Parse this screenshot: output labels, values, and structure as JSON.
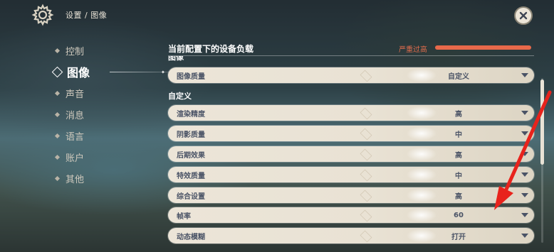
{
  "header": {
    "breadcrumb": "设置 / 图像",
    "gear_icon": "gear-icon",
    "close_icon": "close-icon"
  },
  "sidebar": {
    "items": [
      {
        "label": "控制",
        "active": false
      },
      {
        "label": "图像",
        "active": true
      },
      {
        "label": "声音",
        "active": false
      },
      {
        "label": "消息",
        "active": false
      },
      {
        "label": "语言",
        "active": false
      },
      {
        "label": "账户",
        "active": false
      },
      {
        "label": "其他",
        "active": false
      }
    ]
  },
  "load": {
    "title": "当前配置下的设备负载",
    "status": "严重过高",
    "status_color": "#e8694a"
  },
  "sections": {
    "image_partial": "图像",
    "custom": "自定义"
  },
  "settings": {
    "quality": {
      "label": "图像质量",
      "value": "自定义"
    },
    "rows": [
      {
        "label": "渲染精度",
        "value": "高"
      },
      {
        "label": "阴影质量",
        "value": "中"
      },
      {
        "label": "后期效果",
        "value": "高"
      },
      {
        "label": "特效质量",
        "value": "中"
      },
      {
        "label": "综合设置",
        "value": "高"
      },
      {
        "label": "帧率",
        "value": "60"
      },
      {
        "label": "动态模糊",
        "value": "打开"
      }
    ]
  },
  "annotation": {
    "color": "#e8231c"
  }
}
